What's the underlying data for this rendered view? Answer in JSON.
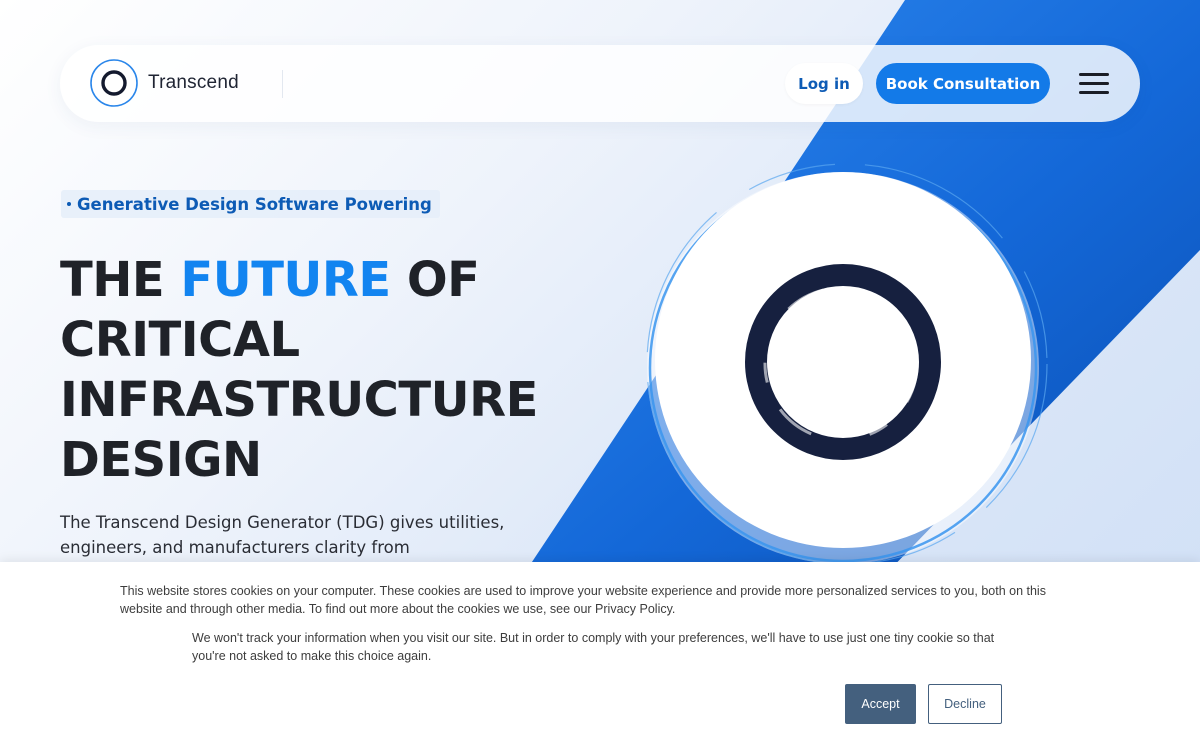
{
  "colors": {
    "brand_blue": "#137ae8",
    "link_blue": "#0d5bb5",
    "accent_blue": "#1284f0",
    "dark_text": "#1f2228",
    "ring_navy": "#16203f",
    "cookie_button": "#44607e"
  },
  "nav": {
    "logo_icon": "ring-logo-icon",
    "brand": "Transcend",
    "login_label": "Log in",
    "book_label": "Book Consultation",
    "menu_icon": "hamburger-menu-icon"
  },
  "hero": {
    "tagline": "Generative Design Software Powering",
    "headline_part1": "THE ",
    "headline_accent": "FUTURE",
    "headline_part2": " OF",
    "headline_line2": "CRITICAL",
    "headline_line3": "INFRASTRUCTURE",
    "headline_line4": "DESIGN",
    "description": "The Transcend Design Generator (TDG) gives utilities, engineers, and manufacturers clarity from"
  },
  "cookie": {
    "text1": "This website stores cookies on your computer. These cookies are used to improve your website experience and provide more personalized services to you, both on this website and through other media. To find out more about the cookies we use, see our Privacy Policy.",
    "text2": "We won't track your information when you visit our site. But in order to comply with your preferences, we'll have to use just one tiny cookie so that you're not asked to make this choice again.",
    "accept_label": "Accept",
    "decline_label": "Decline"
  }
}
